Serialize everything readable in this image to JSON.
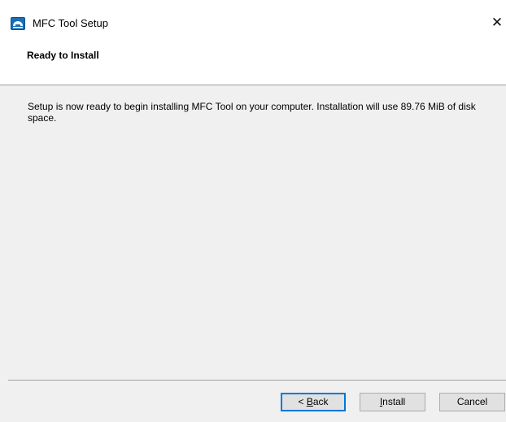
{
  "window": {
    "title": "MFC Tool Setup",
    "close_glyph": "✕",
    "icon": "setup-dialog-icon"
  },
  "header": {
    "title": "Ready to Install"
  },
  "body": {
    "message": "Setup is now ready to begin installing MFC Tool on your computer. Installation will use 89.76 MiB of disk space."
  },
  "buttons": {
    "back_accel": "B",
    "back_rest": "ack",
    "back_prefix": "< ",
    "install_accel": "I",
    "install_rest": "nstall",
    "cancel": "Cancel"
  },
  "colors": {
    "focus_border": "#0078d7",
    "icon_blue": "#1a6fb8"
  }
}
